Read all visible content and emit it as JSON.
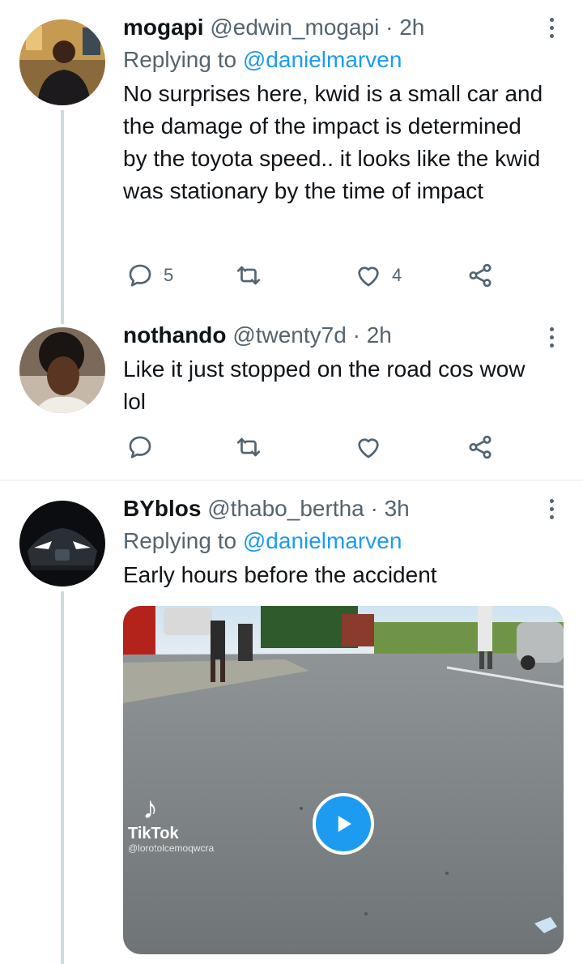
{
  "tweets": [
    {
      "name": "mogapi",
      "handle": "@edwin_mogapi",
      "dot": "·",
      "time": "2h",
      "replying_prefix": "Replying to ",
      "replying_to": "@danielmarven",
      "text": "No surprises here, kwid is a small car and the damage of the impact is determined by the toyota speed.. it looks like the kwid was stationary by the time of impact",
      "reply_count": "5",
      "retweet_count": "",
      "like_count": "4"
    },
    {
      "name": "nothando",
      "handle": "@twenty7d",
      "dot": "·",
      "time": "2h",
      "text": "Like it just stopped on the road cos wow lol",
      "reply_count": "",
      "retweet_count": "",
      "like_count": ""
    },
    {
      "name": "BYblos",
      "handle": "@thabo_bertha",
      "dot": "·",
      "time": "3h",
      "replying_prefix": "Replying to ",
      "replying_to": "@danielmarven",
      "text": "Early hours before the accident",
      "video": {
        "watermark_brand": "TikTok",
        "watermark_user": "@lorotolcemoqwcra"
      }
    }
  ],
  "colors": {
    "accent": "#1d9bf0",
    "secondary_text": "#536471",
    "thread_line": "#cfd9de"
  },
  "icons": [
    "reply-icon",
    "retweet-icon",
    "like-icon",
    "share-icon",
    "more-icon",
    "play-icon"
  ]
}
